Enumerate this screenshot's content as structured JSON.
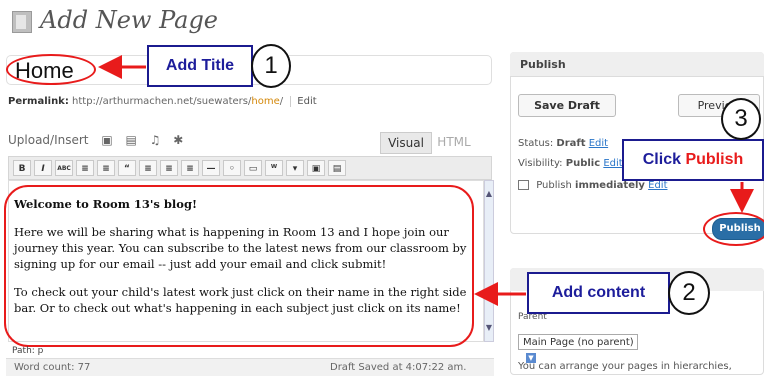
{
  "header": {
    "title": "Add New Page"
  },
  "title_field": {
    "value": "Home"
  },
  "permalink": {
    "label": "Permalink:",
    "base": "http://arthurmachen.net/suewaters/",
    "slug": "home",
    "trail": "/",
    "edit_label": "Edit"
  },
  "editor": {
    "upload_label": "Upload/Insert",
    "tab_visual": "Visual",
    "tab_html": "HTML",
    "toolbar": [
      "B",
      "I",
      "ABC",
      "≡",
      "≡",
      "“",
      "≡",
      "≡",
      "≡",
      "—",
      "◦",
      "▭",
      "ᵂ",
      "▾",
      "▣",
      "▤"
    ],
    "content": {
      "heading": "Welcome to Room 13's blog!",
      "para1": "Here we will be sharing what is happening in Room 13 and I hope join our journey this year.  You can subscribe to the latest news from our classroom by signing up for our email -- just add your email and click submit!",
      "para2": "To check out your child's latest work just click on their name in the right side bar.  Or to check out what's happening in each subject just click on its name!"
    },
    "path": "Path: p",
    "word_count": "Word count: 77",
    "draft_saved": "Draft Saved at 4:07:22 am."
  },
  "publish": {
    "title": "Publish",
    "save_draft": "Save Draft",
    "preview": "Preview",
    "status_label": "Status:",
    "status_value": "Draft",
    "visibility_label": "Visibility:",
    "visibility_value": "Public",
    "publish_label": "Publish",
    "publish_value": "immediately",
    "edit_link": "Edit",
    "publish_button": "Publish"
  },
  "attributes": {
    "parent_label": "Parent",
    "parent_value": "Main Page (no parent)",
    "help_text": "You can arrange your pages in hierarchies,"
  },
  "annotations": {
    "add_title": "Add Title",
    "add_content": "Add content",
    "click": "Click",
    "publish": "Publish",
    "n1": "1",
    "n2": "2",
    "n3": "3"
  },
  "colors": {
    "annotation_red": "#e81b1b",
    "callout_blue": "#1d1d9b",
    "publish_blue": "#2a6ea6"
  }
}
